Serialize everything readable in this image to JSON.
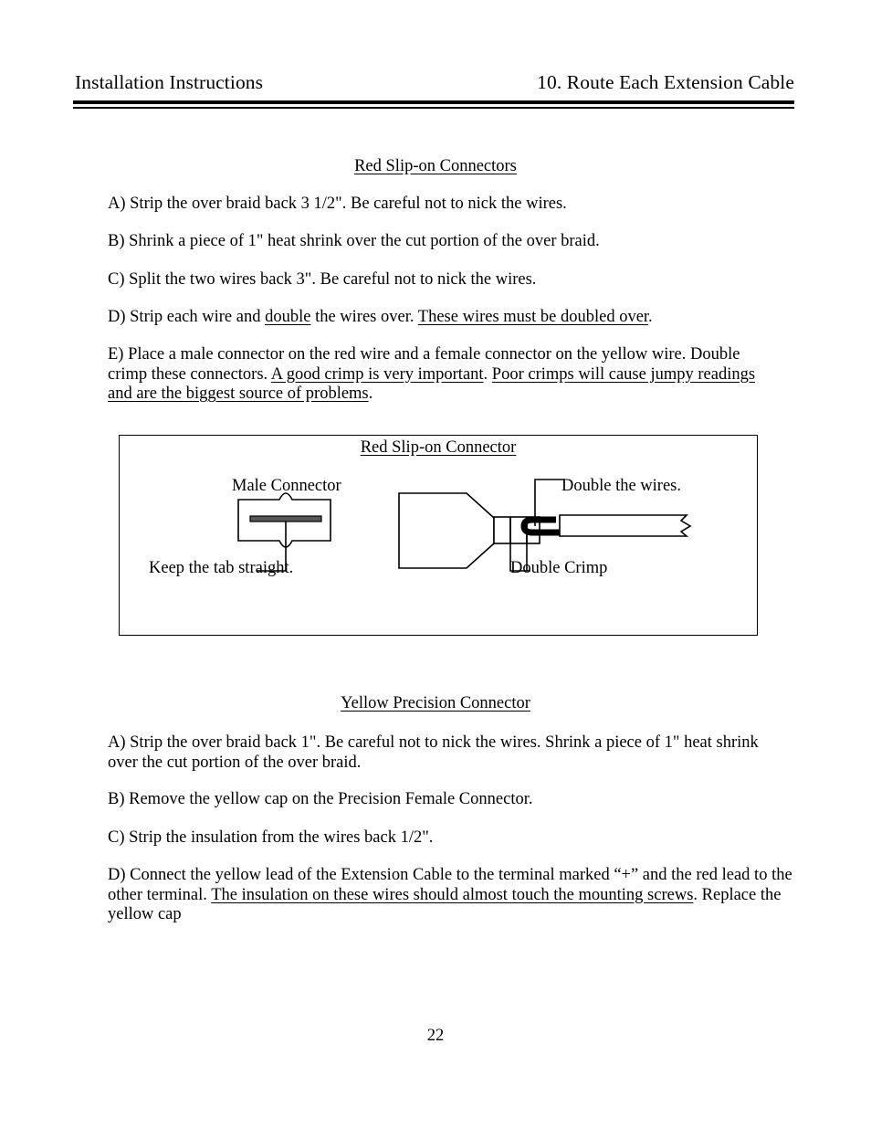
{
  "header": {
    "left": "Installation Instructions",
    "right": "10.  Route Each Extension Cable"
  },
  "sections": {
    "red_slip_on": {
      "title": "Red Slip-on Connectors",
      "items": {
        "a": "A)  Strip the over braid back 3 1/2\".  Be careful not to nick the wires.",
        "b": "B)  Shrink a piece of 1\" heat shrink over the cut portion of the over braid.",
        "c": "C)  Split the two wires back 3\".  Be careful not to nick the wires.",
        "d_part1": "D)  Strip each wire and ",
        "d_underline1": "double",
        "d_part2": " the wires over.  ",
        "d_underline2": "These wires must be doubled over",
        "d_part3": ".",
        "e_part1": "E)   Place a male connector on the red wire and a female connector on the yellow wire.  Double crimp these connectors.  ",
        "e_underline1": "A good crimp is very important",
        "e_part2": ".  ",
        "e_underline2": "Poor crimps will cause jumpy readings and are the biggest source of problems",
        "e_part3": "."
      }
    },
    "yellow_precision": {
      "title": "Yellow Precision Connector",
      "items": {
        "a": "A)  Strip the over braid back 1\".  Be careful not to nick the wires.  Shrink a piece of 1\" heat shrink over the cut portion of the over braid.",
        "b": "B)  Remove the yellow cap on the Precision Female Connector.",
        "c": "C)  Strip the insulation from the wires back 1/2\".",
        "d_part1": "D)  Connect the yellow lead of the Extension Cable to the terminal marked “+” and the red lead to the other terminal.  ",
        "d_underline1": "The insulation on these wires should almost touch the mounting screws",
        "d_part2": ".  Replace the yellow cap"
      }
    }
  },
  "figure": {
    "caption": "Red Slip-on Connector",
    "labels": {
      "male_connector": "Male Connector",
      "keep_tab_straight": "Keep the tab straight.",
      "double_crimp": "Double Crimp",
      "double_the_wires": "Double the wires."
    },
    "colors": {
      "stroke": "#000000",
      "tab_fill": "#58585a",
      "shape_fill": "#ffffff"
    }
  },
  "footer": {
    "page_number": "22"
  }
}
